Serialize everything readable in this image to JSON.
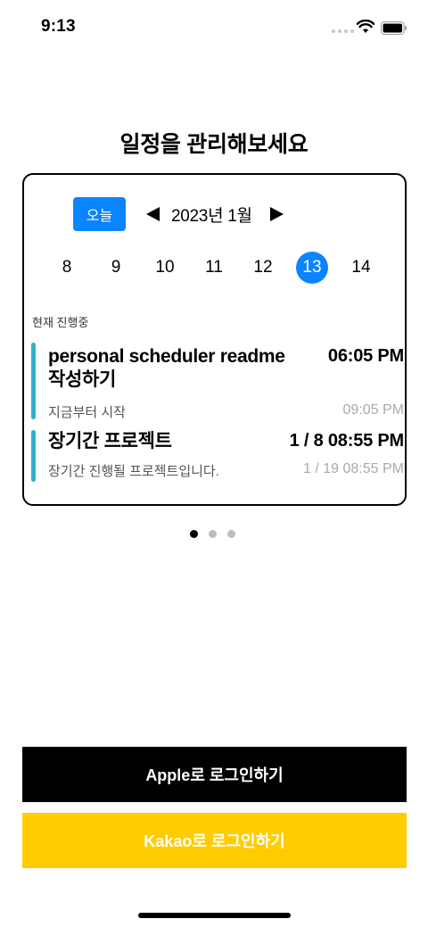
{
  "status_bar": {
    "time": "9:13"
  },
  "headline": "일정을 관리해보세요",
  "calendar": {
    "today_label": "오늘",
    "month_label": "2023년 1월",
    "days": [
      "8",
      "9",
      "10",
      "11",
      "12",
      "13",
      "14"
    ],
    "selected_day": "13",
    "section_label": "현재 진행중"
  },
  "events": [
    {
      "title": "personal scheduler readme 작성하기",
      "start": "06:05 PM",
      "subtitle": "지금부터 시작",
      "end": "09:05 PM"
    },
    {
      "title": "장기간 프로젝트",
      "start": "1 / 8 08:55 PM",
      "subtitle": "장기간 진행될 프로젝트입니다.",
      "end": "1 / 19 08:55 PM"
    }
  ],
  "pagination": {
    "count": 3,
    "active": 1
  },
  "login": {
    "apple_label": "Apple로 로그인하기",
    "kakao_label": "Kakao로 로그인하기"
  },
  "colors": {
    "accent": "#0a84ff",
    "event_bar": "#30b0c7",
    "kakao": "#ffcc00",
    "apple": "#000000"
  }
}
